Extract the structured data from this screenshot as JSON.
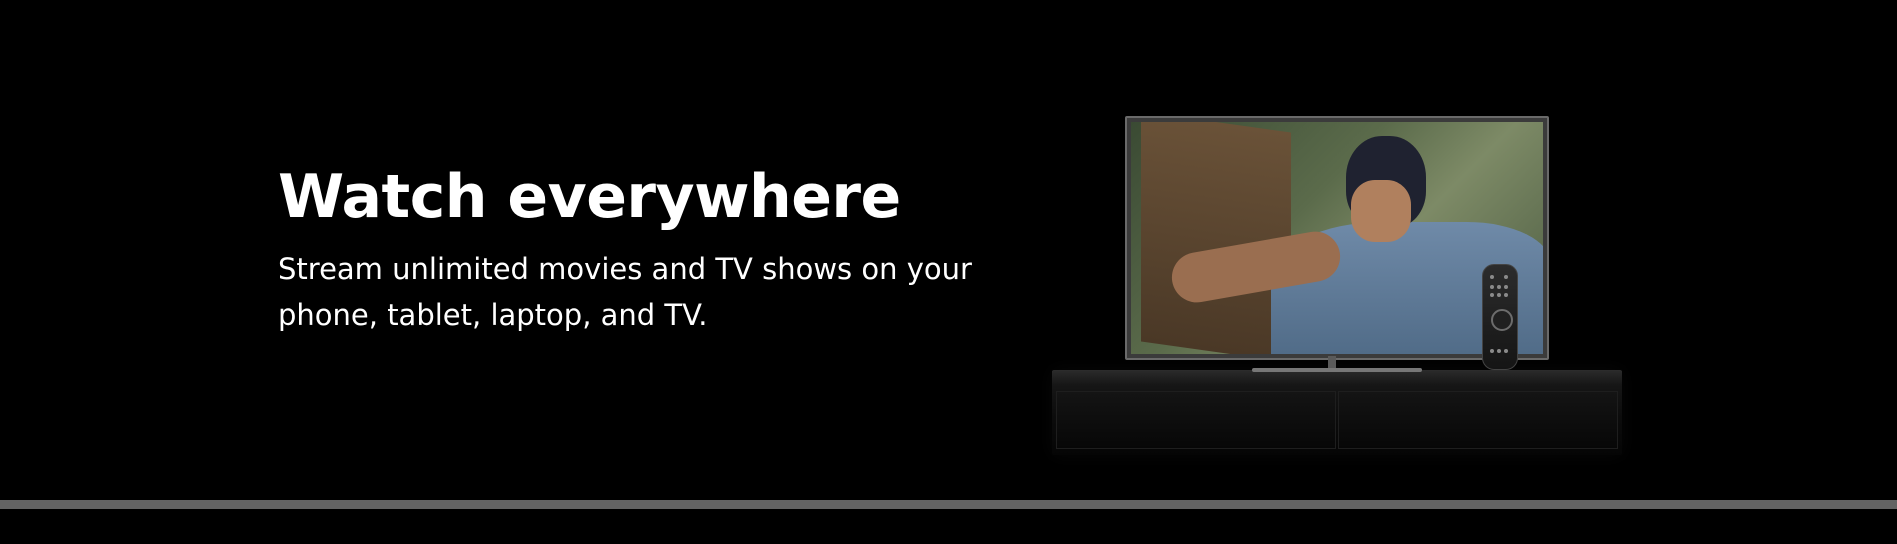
{
  "feature": {
    "title": "Watch everywhere",
    "description": "Stream unlimited movies and TV shows on your phone, tablet, laptop, and TV."
  },
  "media": {
    "subject": "tv-on-cabinet-icon",
    "remote": "remote-control-icon"
  },
  "colors": {
    "background": "#000000",
    "text": "#ffffff",
    "divider": "#636363"
  }
}
